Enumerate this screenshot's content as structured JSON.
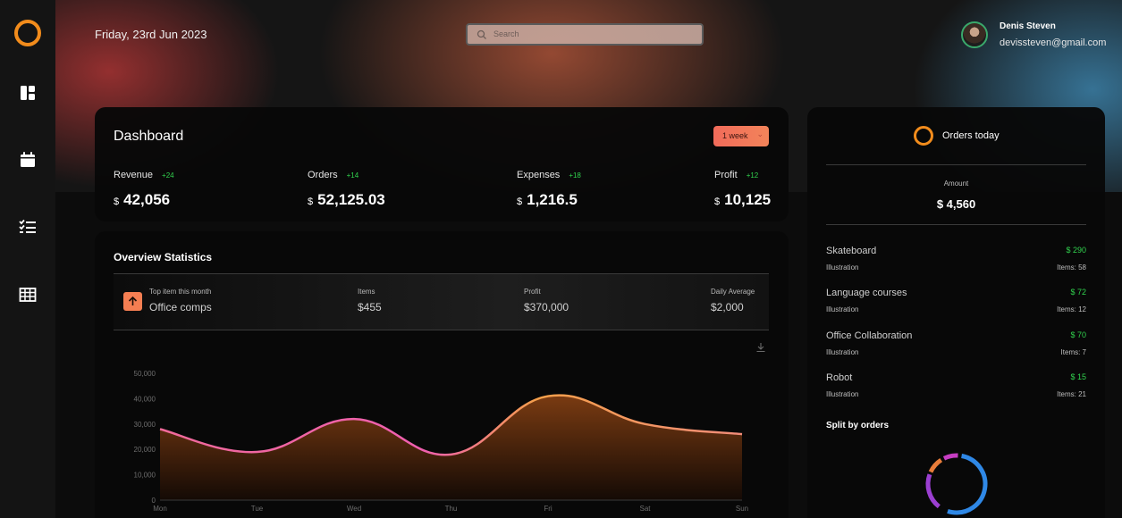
{
  "header": {
    "date": "Friday, 23rd Jun 2023",
    "search_placeholder": "Search",
    "user_name": "Denis Steven",
    "user_email": "devissteven@gmail.com"
  },
  "sidebar": {
    "items": [
      {
        "icon": "layout-icon"
      },
      {
        "icon": "calendar-icon"
      },
      {
        "icon": "checklist-icon"
      },
      {
        "icon": "table-icon"
      }
    ]
  },
  "dashboard": {
    "title": "Dashboard",
    "period": "1 week",
    "metrics": [
      {
        "label": "Revenue",
        "change": "+24",
        "currency": "$",
        "value": "42,056"
      },
      {
        "label": "Orders",
        "change": "+14",
        "currency": "$",
        "value": "52,125.03"
      },
      {
        "label": "Expenses",
        "change": "+18",
        "currency": "$",
        "value": "1,216.5"
      },
      {
        "label": "Profit",
        "change": "+12",
        "currency": "$",
        "value": "10,125"
      }
    ]
  },
  "overview": {
    "title": "Overview Statistics",
    "top_item_label": "Top item this month",
    "top_item_value": "Office comps",
    "items_label": "Items",
    "items_value": "$455",
    "profit_label": "Profit",
    "profit_value": "$370,000",
    "daily_label": "Daily Average",
    "daily_value": "$2,000"
  },
  "chart_data": {
    "type": "area",
    "categories": [
      "Mon",
      "Tue",
      "Wed",
      "Thu",
      "Fri",
      "Sat",
      "Sun"
    ],
    "values": [
      28000,
      19000,
      32000,
      18000,
      41000,
      30000,
      26000
    ],
    "y_ticks": [
      "0",
      "10,000",
      "20,000",
      "30,000",
      "40,000",
      "50,000"
    ],
    "ylim": [
      0,
      50000
    ],
    "grid": false,
    "colors": {
      "line_start": "#f06a9a",
      "line_mid": "#ef5fb0",
      "line_end": "#f5a04a",
      "fill_top": "#7a3b12",
      "fill_bottom": "#140a05"
    }
  },
  "orders": {
    "title": "Orders today",
    "amount_label": "Amount",
    "amount_value": "$ 4,560",
    "products": [
      {
        "name": "Skateboard",
        "price": "$ 290",
        "category": "Illustration",
        "items": "Items: 58"
      },
      {
        "name": "Language courses",
        "price": "$ 72",
        "category": "Illustration",
        "items": "Items: 12"
      },
      {
        "name": "Office Collaboration",
        "price": "$ 70",
        "category": "Illustration",
        "items": "Items: 7"
      },
      {
        "name": "Robot",
        "price": "$ 15",
        "category": "Illustration",
        "items": "Items: 21"
      }
    ],
    "split_title": "Split by orders"
  },
  "colors": {
    "accent": "#f28c1c",
    "positive": "#31d24e",
    "button": "#f16b5a"
  }
}
